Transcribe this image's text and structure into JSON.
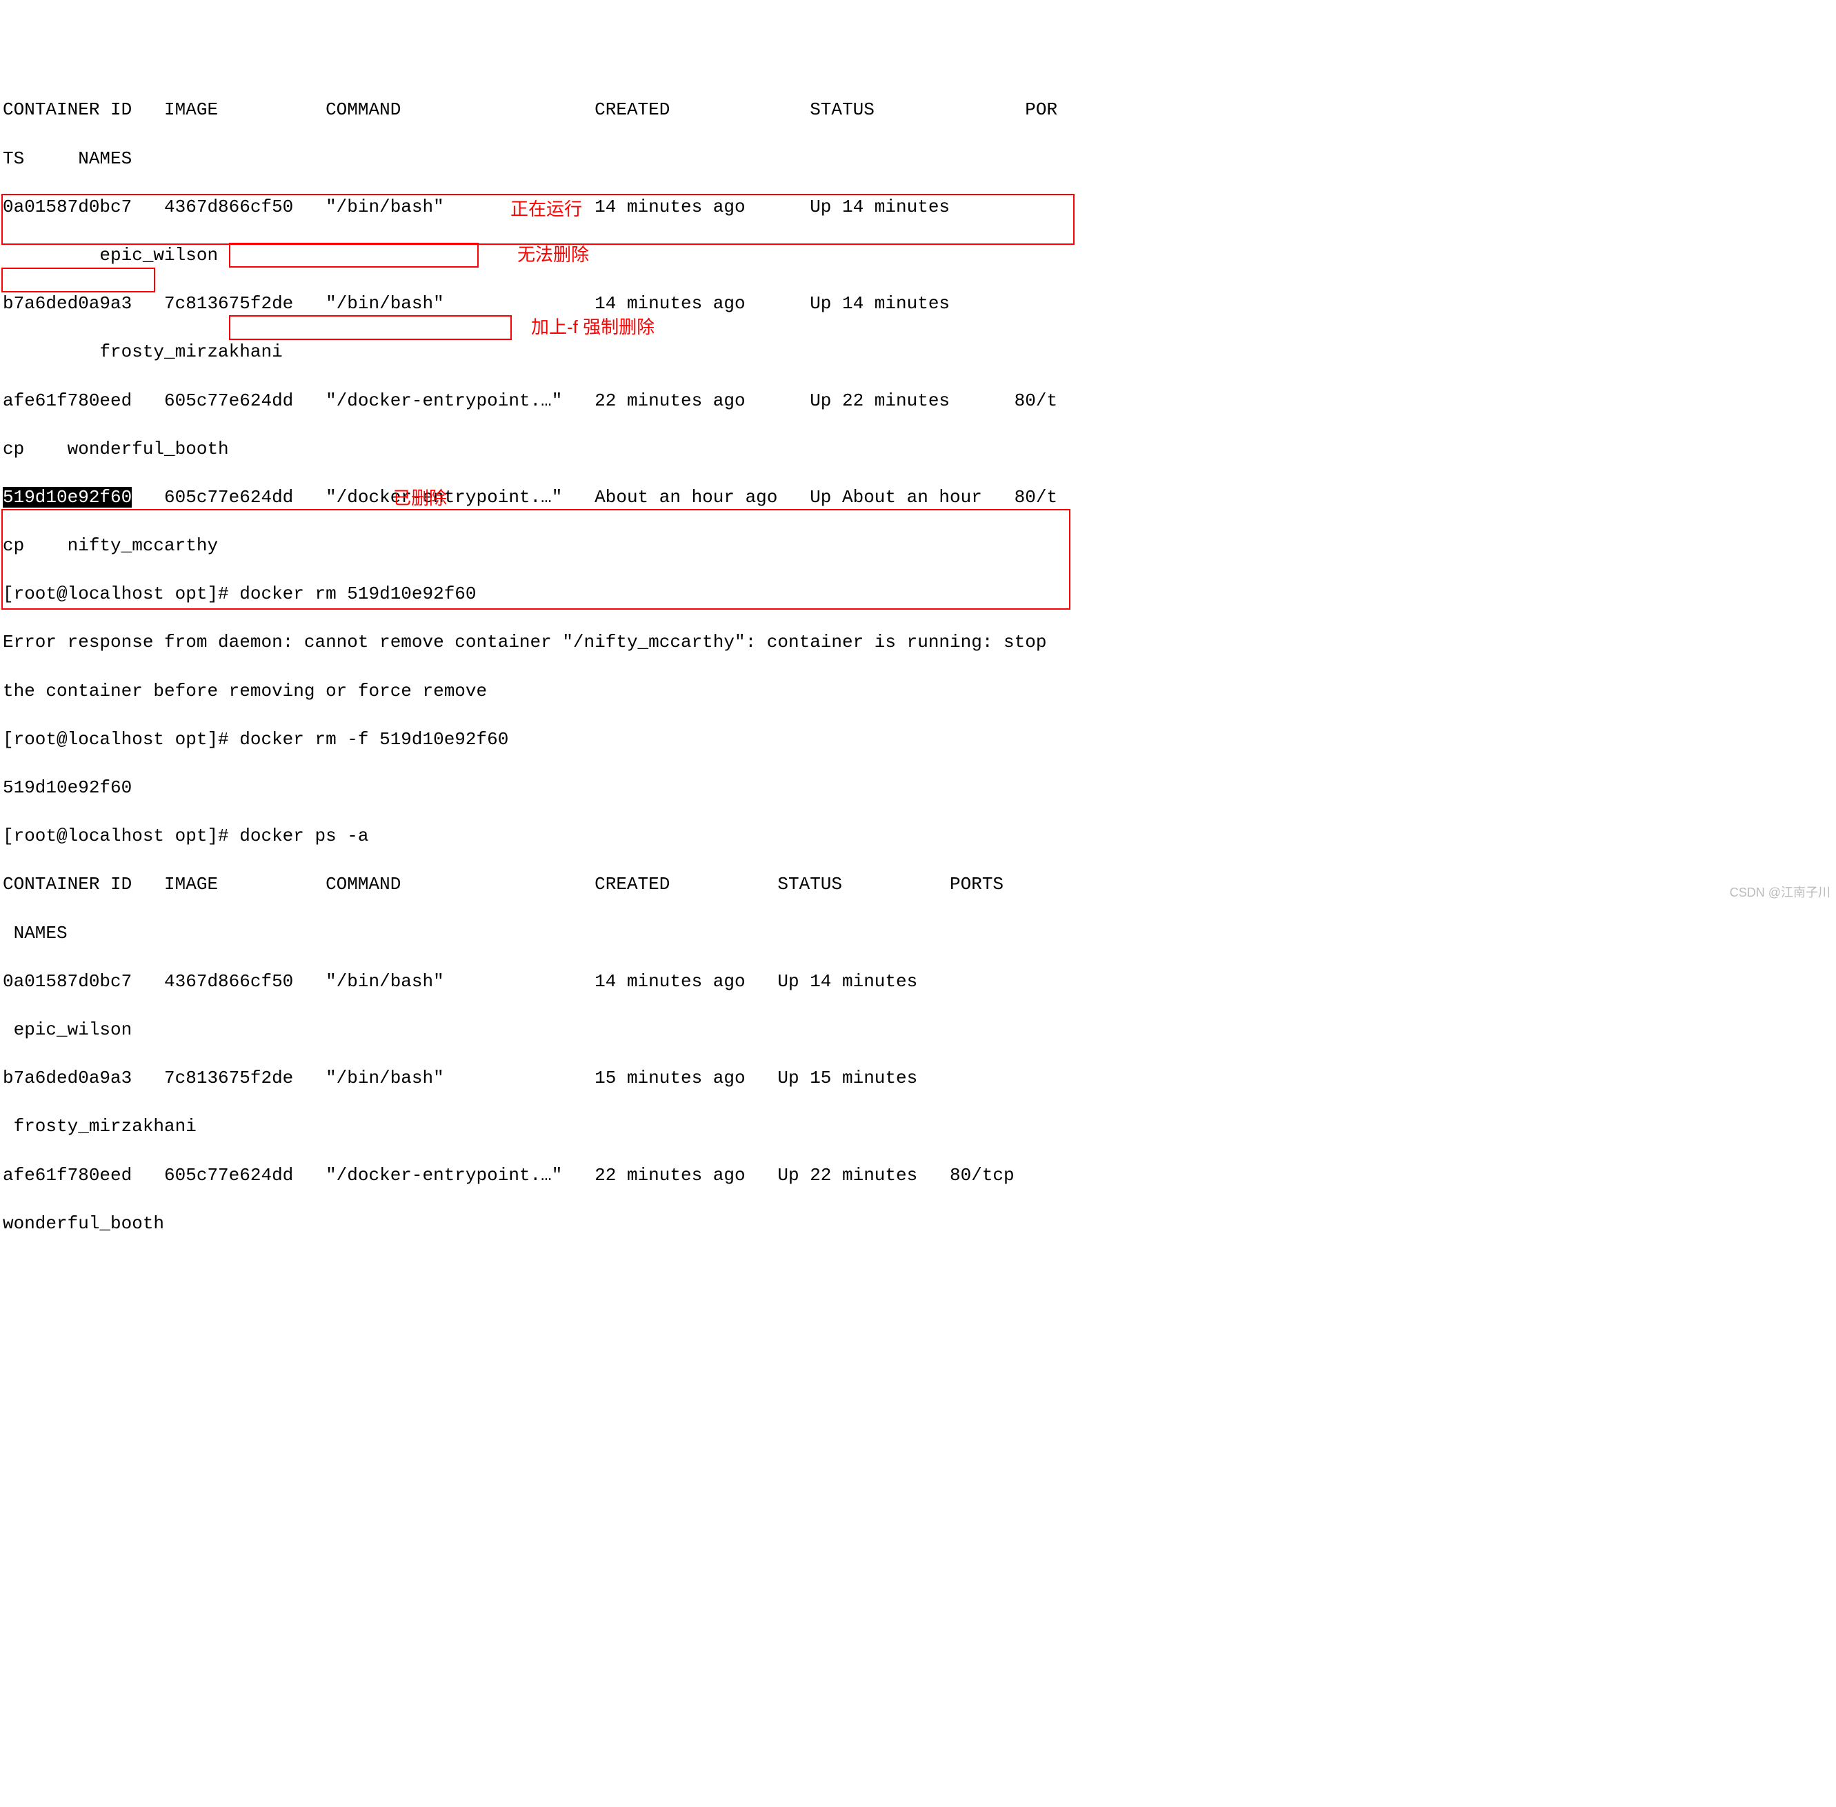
{
  "header1": {
    "line1": "CONTAINER ID   IMAGE          COMMAND                  CREATED             STATUS              POR",
    "line2": "TS     NAMES"
  },
  "rows1": {
    "r1l1": "0a01587d0bc7   4367d866cf50   \"/bin/bash\"              14 minutes ago      Up 14 minutes",
    "r1l2": "         epic_wilson",
    "r2l1": "b7a6ded0a9a3   7c813675f2de   \"/bin/bash\"              14 minutes ago      Up 14 minutes",
    "r2l2": "         frosty_mirzakhani",
    "r3l1": "afe61f780eed   605c77e624dd   \"/docker-entrypoint.…\"   22 minutes ago      Up 22 minutes      80/t",
    "r3l2": "cp    wonderful_booth",
    "r4l1_pre": "",
    "r4l1_id": "519d10e92f60",
    "r4l1_rest": "   605c77e624dd   \"/docker-entrypoint.…\"   About an hour ago   Up About an hour   80/t",
    "r4l2": "cp    nifty_mccarthy"
  },
  "cmds": {
    "rm1": "[root@localhost opt]# docker rm 519d10e92f60",
    "err1": "Error response from daemon: cannot remove container \"/nifty_mccarthy\": container is running: stop",
    "err2": "the container before removing or force remove",
    "rm2": "[root@localhost opt]# docker rm -f 519d10e92f60",
    "rm2_out": "519d10e92f60",
    "psa": "[root@localhost opt]# docker ps -a"
  },
  "header2": {
    "line1": "CONTAINER ID   IMAGE          COMMAND                  CREATED          STATUS          PORTS",
    "line2": " NAMES"
  },
  "rows2": {
    "r1l1": "0a01587d0bc7   4367d866cf50   \"/bin/bash\"              14 minutes ago   Up 14 minutes",
    "r1l2": " epic_wilson",
    "r2l1": "b7a6ded0a9a3   7c813675f2de   \"/bin/bash\"              15 minutes ago   Up 15 minutes",
    "r2l2": " frosty_mirzakhani",
    "r3l1": "afe61f780eed   605c77e624dd   \"/docker-entrypoint.…\"   22 minutes ago   Up 22 minutes   80/tcp",
    "r3l2": "wonderful_booth"
  },
  "annotations": {
    "running": "正在运行",
    "cannot_delete": "无法删除",
    "force_delete": "加上-f 强制删除",
    "deleted": "已删除"
  },
  "watermark": "CSDN @江南子川"
}
